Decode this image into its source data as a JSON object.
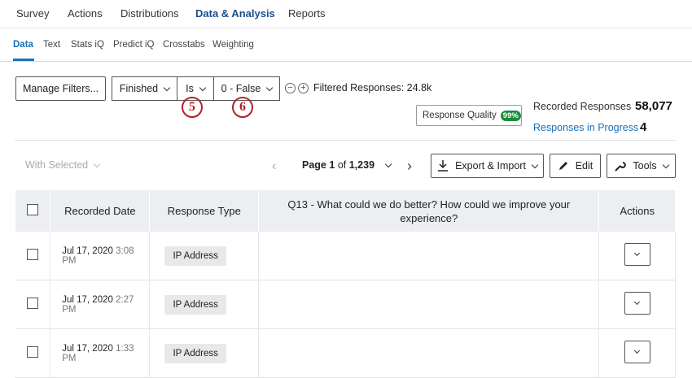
{
  "topnav": {
    "tabs": [
      {
        "label": "Survey"
      },
      {
        "label": "Actions"
      },
      {
        "label": "Distributions"
      },
      {
        "label": "Data & Analysis"
      },
      {
        "label": "Reports"
      }
    ]
  },
  "subnav": {
    "tabs": [
      {
        "label": "Data"
      },
      {
        "label": "Text"
      },
      {
        "label": "Stats iQ"
      },
      {
        "label": "Predict iQ"
      },
      {
        "label": "Crosstabs"
      },
      {
        "label": "Weighting"
      }
    ]
  },
  "filters": {
    "manage_label": "Manage Filters...",
    "field_value": "Finished",
    "operator_value": "Is",
    "value_value": "0 - False",
    "filtered_label": "Filtered Responses: 24.8k",
    "markers": [
      "5",
      "6"
    ]
  },
  "summary": {
    "quality_label": "Response Quality",
    "quality_badge": "99%",
    "recorded_label": "Recorded Responses",
    "recorded_value": "58,077",
    "in_progress_label": "Responses in Progress",
    "in_progress_value": "4"
  },
  "toolbar": {
    "with_selected": "With Selected",
    "page_prefix": "Page",
    "page_current": "1",
    "page_of": "of",
    "page_total": "1,239",
    "export_label": "Export & Import",
    "edit_label": "Edit",
    "tools_label": "Tools"
  },
  "table": {
    "headers": {
      "date": "Recorded Date",
      "type": "Response Type",
      "q13": "Q13 - What could we do better? How could we improve your experience?",
      "actions": "Actions"
    },
    "rows": [
      {
        "date": "Jul 17, 2020",
        "time": "3:08 PM",
        "type": "IP Address"
      },
      {
        "date": "Jul 17, 2020",
        "time": "2:27 PM",
        "type": "IP Address"
      },
      {
        "date": "Jul 17, 2020",
        "time": "1:33 PM",
        "type": "IP Address"
      }
    ]
  },
  "colors": {
    "accent": "#1a70b8",
    "marker": "#b0212b",
    "badge_green": "#1d8a3a"
  }
}
